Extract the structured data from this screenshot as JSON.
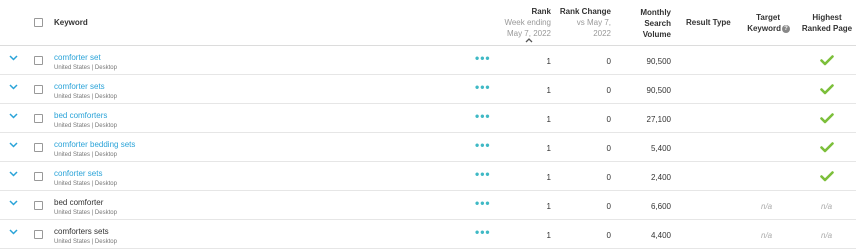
{
  "header": {
    "keyword": "Keyword",
    "rank": "Rank",
    "rank_sub1": "Week ending",
    "rank_sub2": "May 7, 2022",
    "rank_change": "Rank Change",
    "rank_change_sub1": "vs May 7,",
    "rank_change_sub2": "2022",
    "msv1": "Monthly",
    "msv2": "Search",
    "msv3": "Volume",
    "result_type": "Result Type",
    "target1": "Target",
    "target2": "Keyword",
    "target_help": "?",
    "highest1": "Highest",
    "highest2": "Ranked Page"
  },
  "rows": [
    {
      "keyword": "comforter set",
      "location": "United States | Desktop",
      "rank": "1",
      "change": "0",
      "volume": "90,500",
      "target": "",
      "highest": "check",
      "link": true
    },
    {
      "keyword": "comforter sets",
      "location": "United States | Desktop",
      "rank": "1",
      "change": "0",
      "volume": "90,500",
      "target": "",
      "highest": "check",
      "link": true
    },
    {
      "keyword": "bed comforters",
      "location": "United States | Desktop",
      "rank": "1",
      "change": "0",
      "volume": "27,100",
      "target": "",
      "highest": "check",
      "link": true
    },
    {
      "keyword": "comforter bedding sets",
      "location": "United States | Desktop",
      "rank": "1",
      "change": "0",
      "volume": "5,400",
      "target": "",
      "highest": "check",
      "link": true
    },
    {
      "keyword": "conforter sets",
      "location": "United States | Desktop",
      "rank": "1",
      "change": "0",
      "volume": "2,400",
      "target": "",
      "highest": "check",
      "link": true
    },
    {
      "keyword": "bed comforter",
      "location": "United States | Desktop",
      "rank": "1",
      "change": "0",
      "volume": "6,600",
      "target": "n/a",
      "highest": "n/a",
      "link": false
    },
    {
      "keyword": "comforters sets",
      "location": "United States | Desktop",
      "rank": "1",
      "change": "0",
      "volume": "4,400",
      "target": "n/a",
      "highest": "n/a",
      "link": false
    }
  ],
  "row_action_glyph": "•••",
  "colors": {
    "link": "#2aa3d8",
    "check": "#7cbf3a",
    "chevron": "#2aa3d8",
    "dots": "#3fb9c5"
  }
}
